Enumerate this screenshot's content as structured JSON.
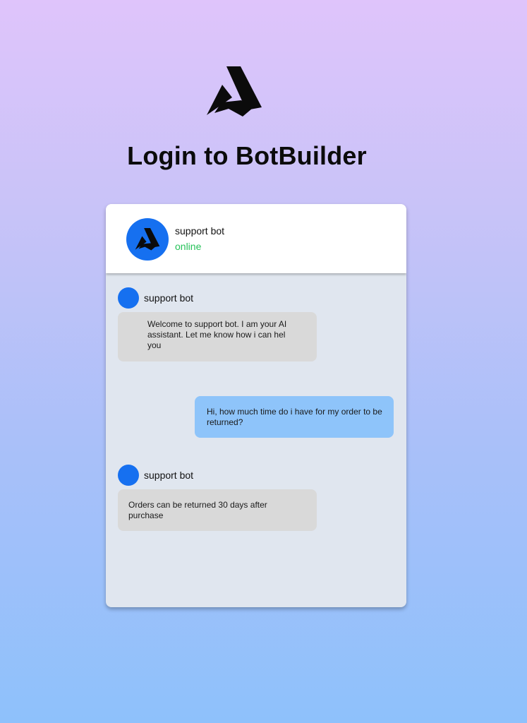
{
  "page": {
    "title": "Login to BotBuilder"
  },
  "chat": {
    "header": {
      "name": "support bot",
      "status": "online"
    },
    "messages": [
      {
        "from": "bot",
        "sender": "support bot",
        "text": "Welcome to support bot. I am your AI assistant. Let me know how i can hel you"
      },
      {
        "from": "user",
        "text": "Hi, how much time do i have for my order to be returned?"
      },
      {
        "from": "bot",
        "sender": "support bot",
        "text": "Orders can be returned 30 days after purchase"
      }
    ]
  },
  "colors": {
    "accent": "#1670f0",
    "online": "#27c25a",
    "bot_bubble": "#d9d9d9",
    "user_bubble": "#8ec4fa"
  },
  "icons": {
    "logo": "botbuilder-logo-icon"
  }
}
